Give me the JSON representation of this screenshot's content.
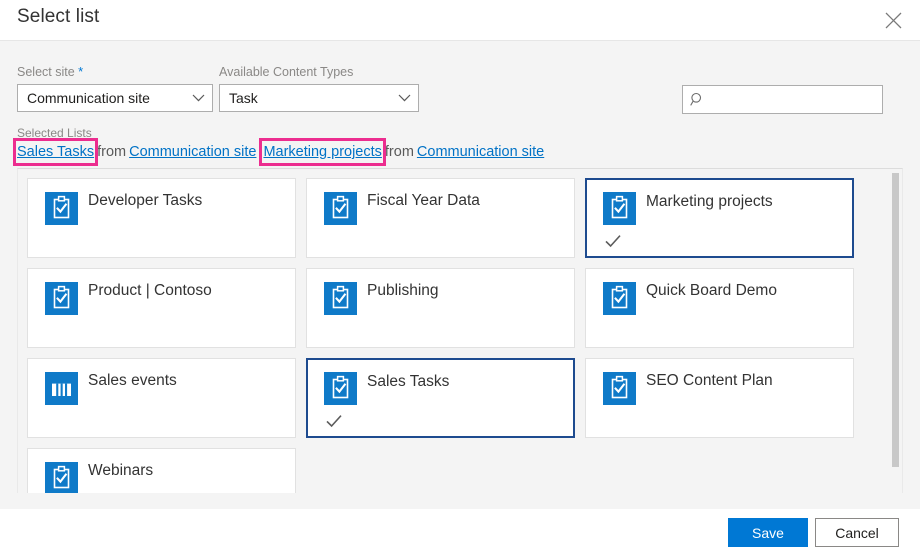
{
  "dialog": {
    "title": "Select list",
    "close_icon": "close-icon"
  },
  "fields": {
    "site": {
      "label": "Select site",
      "required_marker": "*",
      "value": "Communication site",
      "caret_icon": "chevron-down-icon"
    },
    "content_types": {
      "label": "Available Content Types",
      "value": "Task",
      "caret_icon": "chevron-down-icon"
    }
  },
  "search": {
    "icon": "search-icon",
    "value": "",
    "placeholder": ""
  },
  "selected": {
    "caption": "Selected Lists",
    "items": [
      {
        "list_name": "Sales Tasks",
        "connector": "from",
        "site_name": "Communication site",
        "highlighted": true
      },
      {
        "list_name": "Marketing projects",
        "connector": "from",
        "site_name": "Communication site",
        "highlighted": true
      }
    ],
    "highlight_color": "#ec2d8f",
    "link_color": "#0072c6"
  },
  "cards": [
    {
      "title": "Developer Tasks",
      "icon": "task-list-icon",
      "selected": false,
      "check_icon": ""
    },
    {
      "title": "Fiscal Year Data",
      "icon": "task-list-icon",
      "selected": false,
      "check_icon": ""
    },
    {
      "title": "Marketing projects",
      "icon": "task-list-icon",
      "selected": true,
      "check_icon": "check-icon"
    },
    {
      "title": "Product | Contoso",
      "icon": "task-list-icon",
      "selected": false,
      "check_icon": ""
    },
    {
      "title": "Publishing",
      "icon": "task-list-icon",
      "selected": false,
      "check_icon": ""
    },
    {
      "title": "Quick Board Demo",
      "icon": "task-list-icon",
      "selected": false,
      "check_icon": ""
    },
    {
      "title": "Sales events",
      "icon": "generic-list-icon",
      "selected": false,
      "check_icon": ""
    },
    {
      "title": "Sales Tasks",
      "icon": "task-list-icon",
      "selected": true,
      "check_icon": "check-icon"
    },
    {
      "title": "SEO Content Plan",
      "icon": "task-list-icon",
      "selected": false,
      "check_icon": ""
    },
    {
      "title": "Webinars",
      "icon": "task-list-icon",
      "selected": false,
      "check_icon": ""
    }
  ],
  "scrollbar": {
    "name": "vertical-scrollbar"
  },
  "footer": {
    "save_label": "Save",
    "cancel_label": "Cancel",
    "primary_color": "#0078d4"
  }
}
